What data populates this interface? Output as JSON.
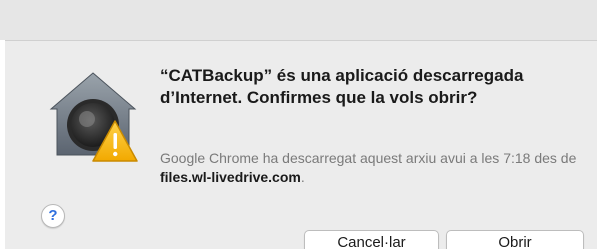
{
  "dialog": {
    "title": "“CATBackup” és una aplicació descarregada d’Internet. Confirmes que la vols obrir?",
    "detail_prefix": "Google Chrome ha descarregat aquest arxiu avui a les 7:18 des de ",
    "detail_host": "files.wl-livedrive.com",
    "detail_suffix": ".",
    "icon": "gatekeeper-lock-warning-icon"
  },
  "buttons": {
    "help_label": "?",
    "cancel_label": "Cancel·lar",
    "open_label": "Obrir"
  }
}
